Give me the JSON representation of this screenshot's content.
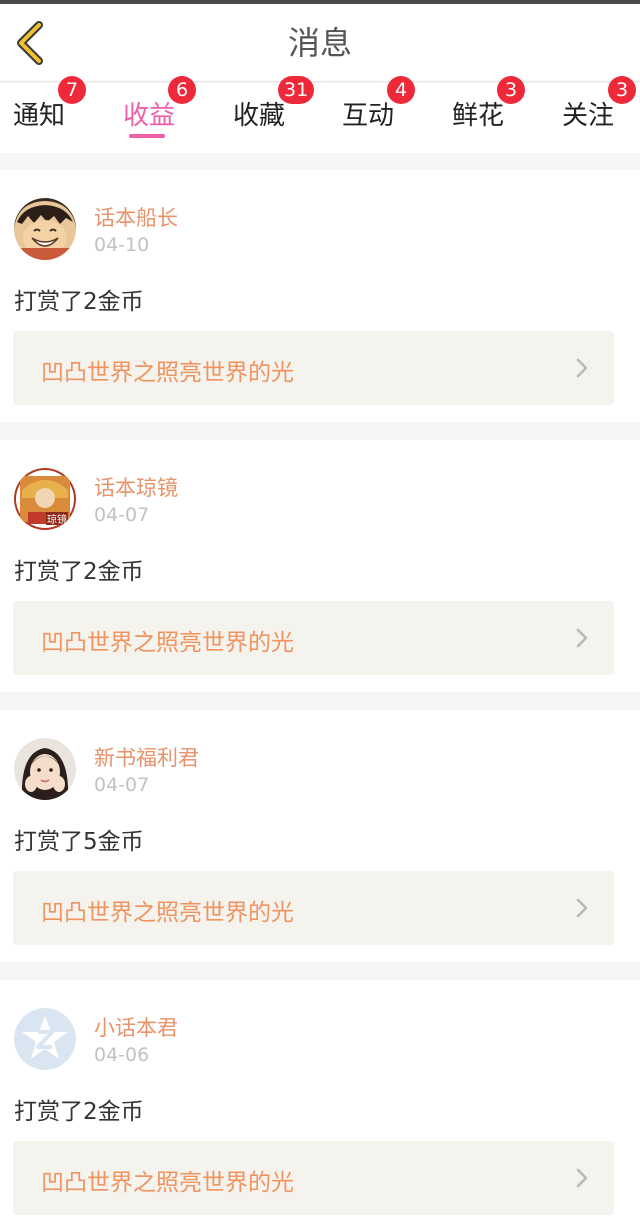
{
  "nav": {
    "title": "消息"
  },
  "tabs": [
    {
      "label": "通知",
      "badge": "7"
    },
    {
      "label": "收益",
      "badge": "6",
      "active": true
    },
    {
      "label": "收藏",
      "badge": "31"
    },
    {
      "label": "互动",
      "badge": "4"
    },
    {
      "label": "鲜花",
      "badge": "3"
    },
    {
      "label": "关注",
      "badge": "3"
    }
  ],
  "messages": [
    {
      "user": "话本船长",
      "date": "04-10",
      "text": "打赏了2金币",
      "book": "凹凸世界之照亮世界的光"
    },
    {
      "user": "话本琼镜",
      "date": "04-07",
      "text": "打赏了2金币",
      "book": "凹凸世界之照亮世界的光",
      "avatar_text": "琼镜"
    },
    {
      "user": "新书福利君",
      "date": "04-07",
      "text": "打赏了5金币",
      "book": "凹凸世界之照亮世界的光"
    },
    {
      "user": "小话本君",
      "date": "04-06",
      "text": "打赏了2金币",
      "book": "凹凸世界之照亮世界的光"
    }
  ],
  "colors": {
    "accent_pink": "#ef5fa7",
    "badge_red": "#ee2a3a",
    "username_orange": "#e8936a",
    "book_orange": "#f0935f",
    "back_yellow": "#f2c12e"
  },
  "icons": [
    "back-chevron-icon",
    "chevron-right-icon"
  ]
}
